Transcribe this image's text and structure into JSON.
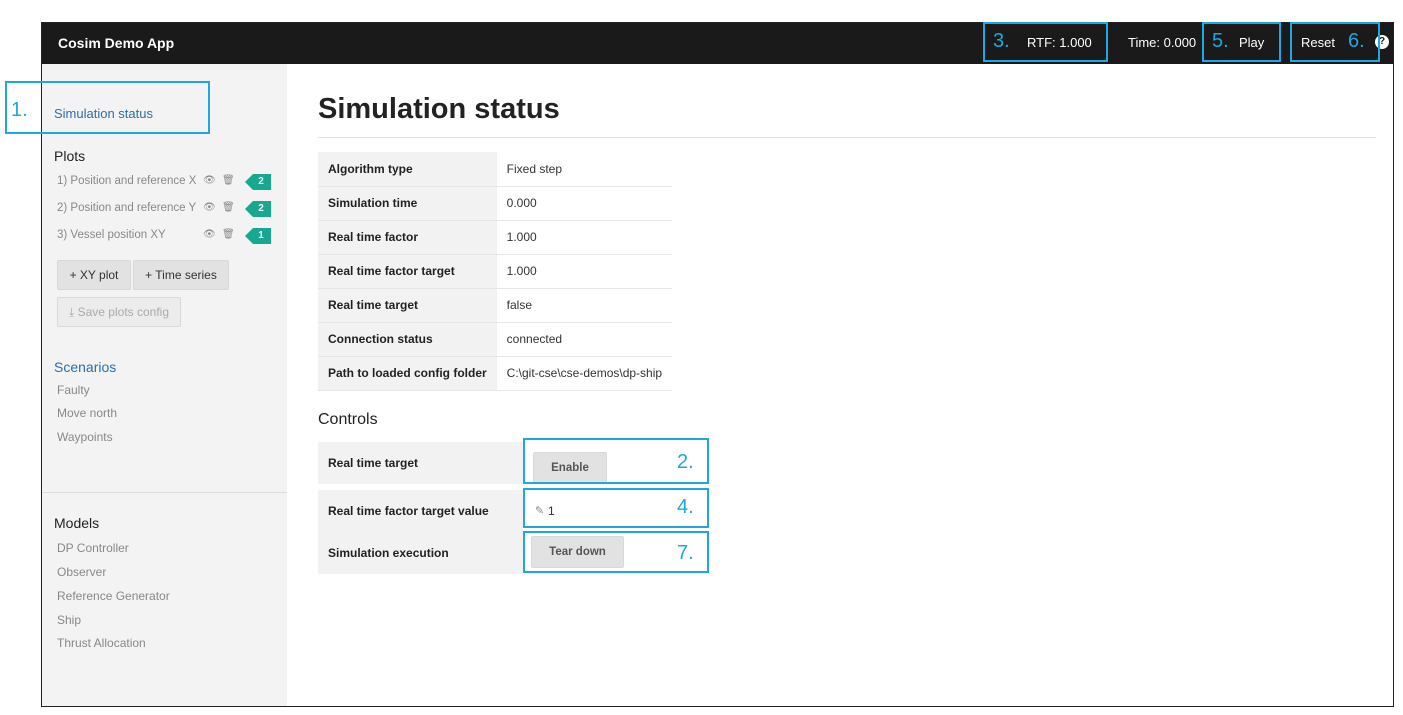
{
  "app": {
    "title": "Cosim Demo App"
  },
  "navbar": {
    "rtf": "RTF: 1.000",
    "time": "Time: 0.000",
    "play": "Play",
    "reset": "Reset",
    "help_icon": "question-circle-icon"
  },
  "sidebar": {
    "active_link": "Simulation status",
    "plots_heading": "Plots",
    "plots": [
      {
        "label": "1) Position and reference X",
        "count": "2"
      },
      {
        "label": "2) Position and reference Y",
        "count": "2"
      },
      {
        "label": "3) Vessel position XY",
        "count": "1"
      }
    ],
    "add_xy_plot": "+ XY plot",
    "add_time_series": "+ Time series",
    "save_plots_config": "Save plots config",
    "scenarios_heading": "Scenarios",
    "scenarios": [
      "Faulty",
      "Move north",
      "Waypoints"
    ],
    "models_heading": "Models",
    "models": [
      "DP Controller",
      "Observer",
      "Reference Generator",
      "Ship",
      "Thrust Allocation"
    ]
  },
  "main": {
    "title": "Simulation status",
    "status_rows": [
      {
        "key": "Algorithm type",
        "value": "Fixed step"
      },
      {
        "key": "Simulation time",
        "value": "0.000"
      },
      {
        "key": "Real time factor",
        "value": "1.000"
      },
      {
        "key": "Real time factor target",
        "value": "1.000"
      },
      {
        "key": "Real time target",
        "value": "false"
      },
      {
        "key": "Connection status",
        "value": "connected"
      },
      {
        "key": "Path to loaded config folder",
        "value": "C:\\git-cse\\cse-demos\\dp-ship"
      }
    ],
    "controls_heading": "Controls",
    "controls": {
      "real_time_target_label": "Real time target",
      "enable_button": "Enable",
      "rtf_target_value_label": "Real time factor target value",
      "rtf_target_value": "1",
      "simulation_execution_label": "Simulation execution",
      "tear_down_button": "Tear down"
    }
  },
  "annotations": {
    "n1": "1.",
    "n2": "2.",
    "n3": "3.",
    "n4": "4.",
    "n5": "5.",
    "n6": "6.",
    "n7": "7.",
    "color": "#1ea7e0"
  }
}
